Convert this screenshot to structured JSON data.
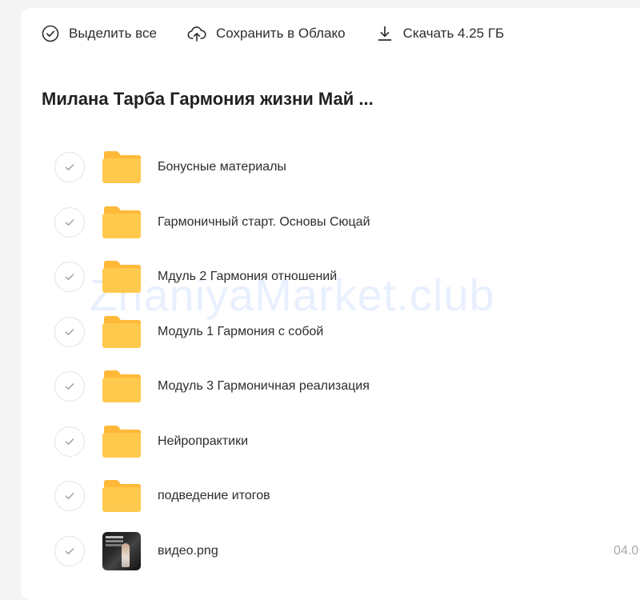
{
  "toolbar": {
    "select_all_label": "Выделить все",
    "save_cloud_label": "Сохранить в Облако",
    "download_label": "Скачать 4.25 ГБ"
  },
  "folder_title": "Милана Тарба Гармония жизни Май ...",
  "items": [
    {
      "name": "Бонусные материалы",
      "type": "folder"
    },
    {
      "name": "Гармоничный старт. Основы Сюцай",
      "type": "folder"
    },
    {
      "name": "Мдуль 2 Гармония отношений",
      "type": "folder"
    },
    {
      "name": "Модуль 1 Гармония с собой",
      "type": "folder"
    },
    {
      "name": "Модуль 3 Гармоничная реализация",
      "type": "folder"
    },
    {
      "name": "Нейропрактики",
      "type": "folder"
    },
    {
      "name": "подведение итогов",
      "type": "folder"
    },
    {
      "name": "видео.png",
      "type": "image",
      "date": "04.0"
    }
  ],
  "watermark": "ZnaniyaMarket.club",
  "colors": {
    "folder": "#ffc94d",
    "folder_tab": "#ffb938",
    "check": "#a3a4a6"
  }
}
